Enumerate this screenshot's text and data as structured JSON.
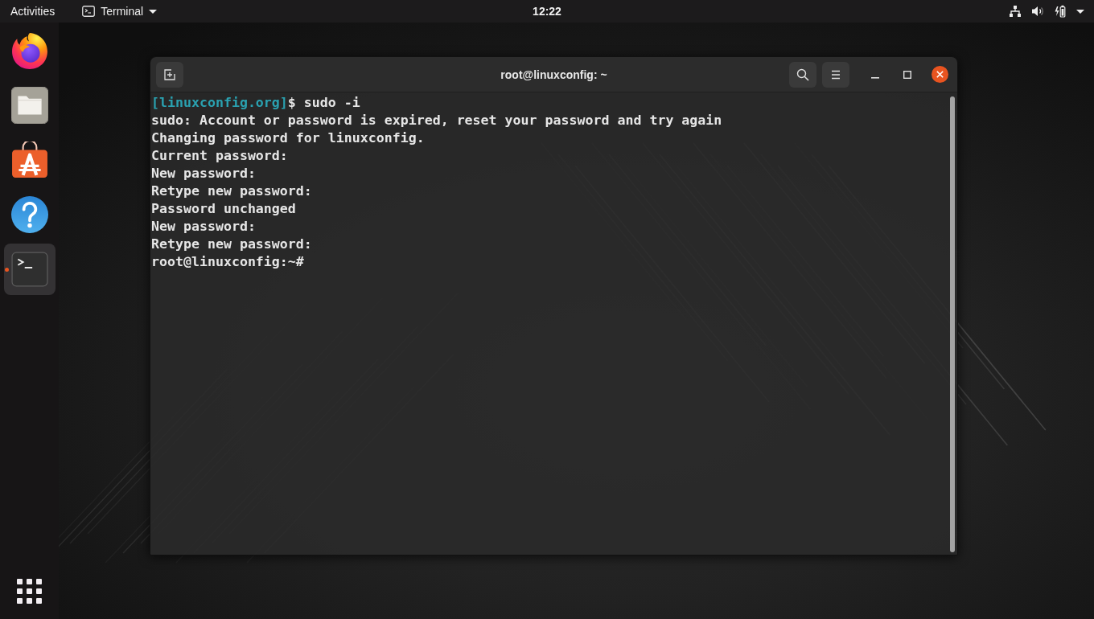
{
  "top_bar": {
    "activities": "Activities",
    "app_menu": {
      "label": "Terminal"
    },
    "clock": "12:22"
  },
  "dock": {
    "items": [
      {
        "kind": "firefox",
        "selected": false,
        "running": false
      },
      {
        "kind": "files",
        "selected": false,
        "running": false
      },
      {
        "kind": "software",
        "selected": false,
        "running": false
      },
      {
        "kind": "help",
        "selected": false,
        "running": false
      },
      {
        "kind": "terminal",
        "selected": true,
        "running": true
      }
    ]
  },
  "terminal_window": {
    "title": "root@linuxconfig: ~",
    "lines": [
      {
        "prompt": "[linuxconfig.org]",
        "text": "$ sudo -i"
      },
      {
        "text": "sudo: Account or password is expired, reset your password and try again"
      },
      {
        "text": "Changing password for linuxconfig."
      },
      {
        "text": "Current password:"
      },
      {
        "text": "New password:"
      },
      {
        "text": "Retype new password:"
      },
      {
        "text": "Password unchanged"
      },
      {
        "text": "New password:"
      },
      {
        "text": "Retype new password:"
      },
      {
        "text": "root@linuxconfig:~#"
      }
    ]
  }
}
